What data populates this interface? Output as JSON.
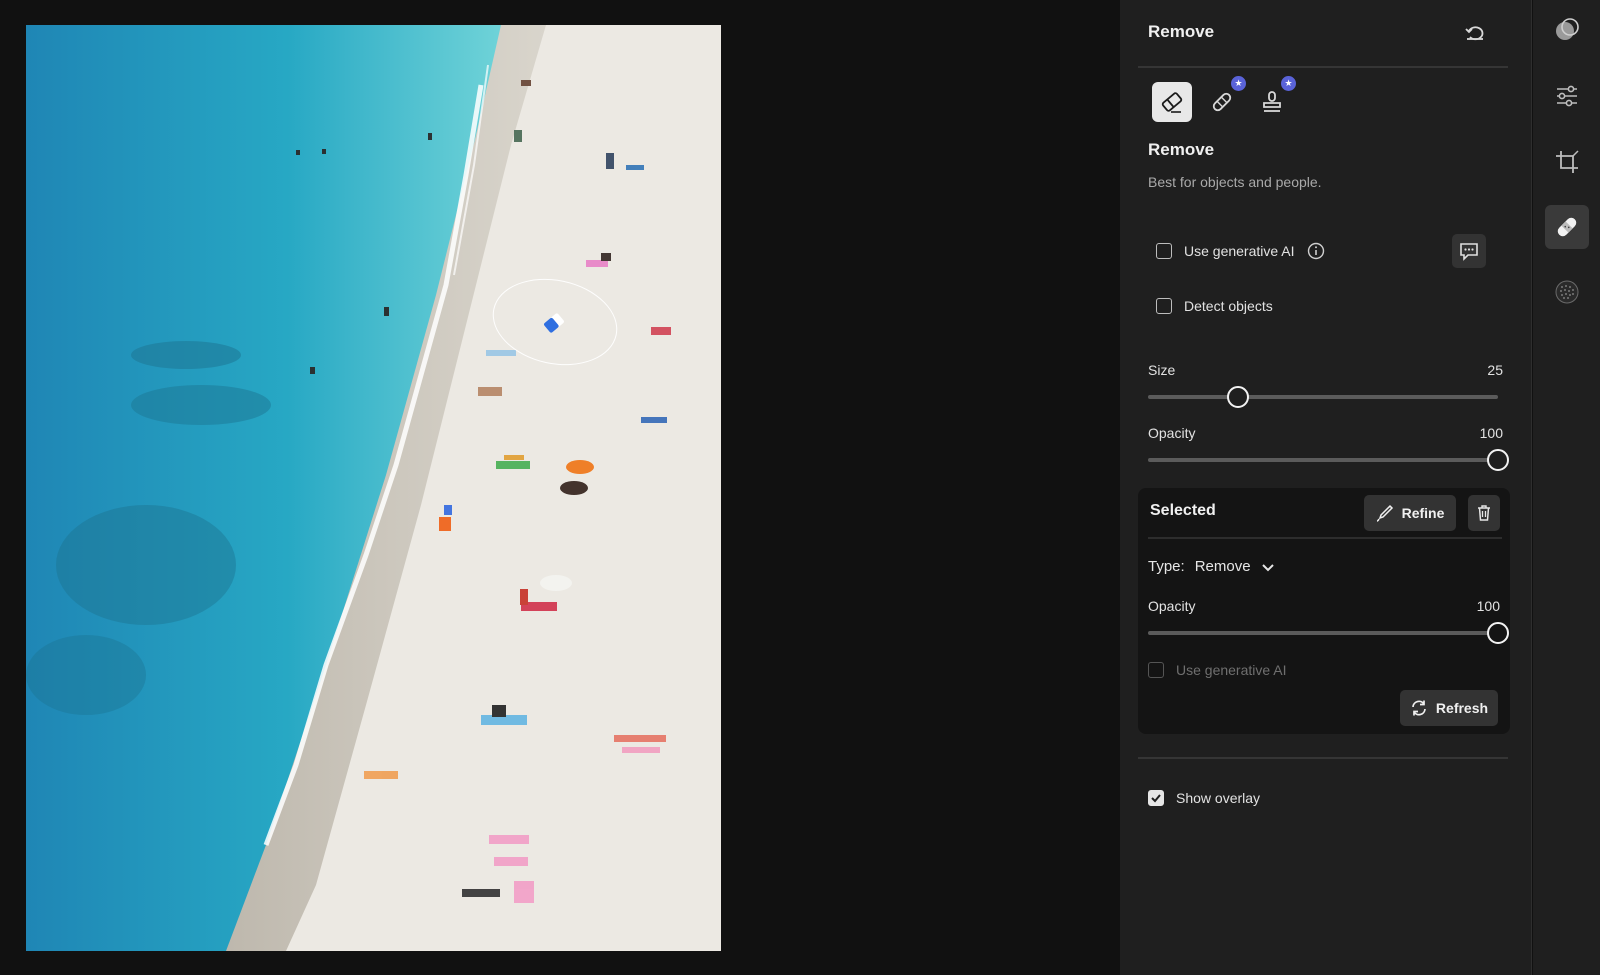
{
  "panel": {
    "title": "Remove",
    "tools": [
      {
        "name": "Remove",
        "icon": "eraser-icon",
        "active": true
      },
      {
        "name": "Heal",
        "icon": "bandage-icon",
        "badge": "★"
      },
      {
        "name": "Clone",
        "icon": "stamp-icon",
        "badge": "★"
      }
    ],
    "section_title": "Remove",
    "section_desc": "Best for objects and people.",
    "use_gen_ai_label": "Use generative AI",
    "detect_objects_label": "Detect objects",
    "size": {
      "label": "Size",
      "value": "25",
      "fraction": 0.257
    },
    "opacity": {
      "label": "Opacity",
      "value": "100",
      "fraction": 1.0
    },
    "selected": {
      "title": "Selected",
      "refine_label": "Refine",
      "type_label": "Type:",
      "type_value": "Remove",
      "opacity_label": "Opacity",
      "opacity_value": "100",
      "opacity_fraction": 1.0,
      "gen_ai_label": "Use generative AI",
      "refresh_label": "Refresh"
    },
    "show_overlay_label": "Show overlay",
    "show_overlay_checked": true
  },
  "rail": {
    "items": [
      "masking-icon",
      "adjust-sliders-icon",
      "crop-icon",
      "heal-bandage-icon",
      "grain-icon"
    ],
    "active": "heal-bandage-icon"
  },
  "colors": {
    "panel_bg": "#1f1f1f",
    "canvas_bg": "#111111",
    "accent_badge": "#5a63d8",
    "sea": "#2aa6c0",
    "sand": "#e9e7e2"
  }
}
